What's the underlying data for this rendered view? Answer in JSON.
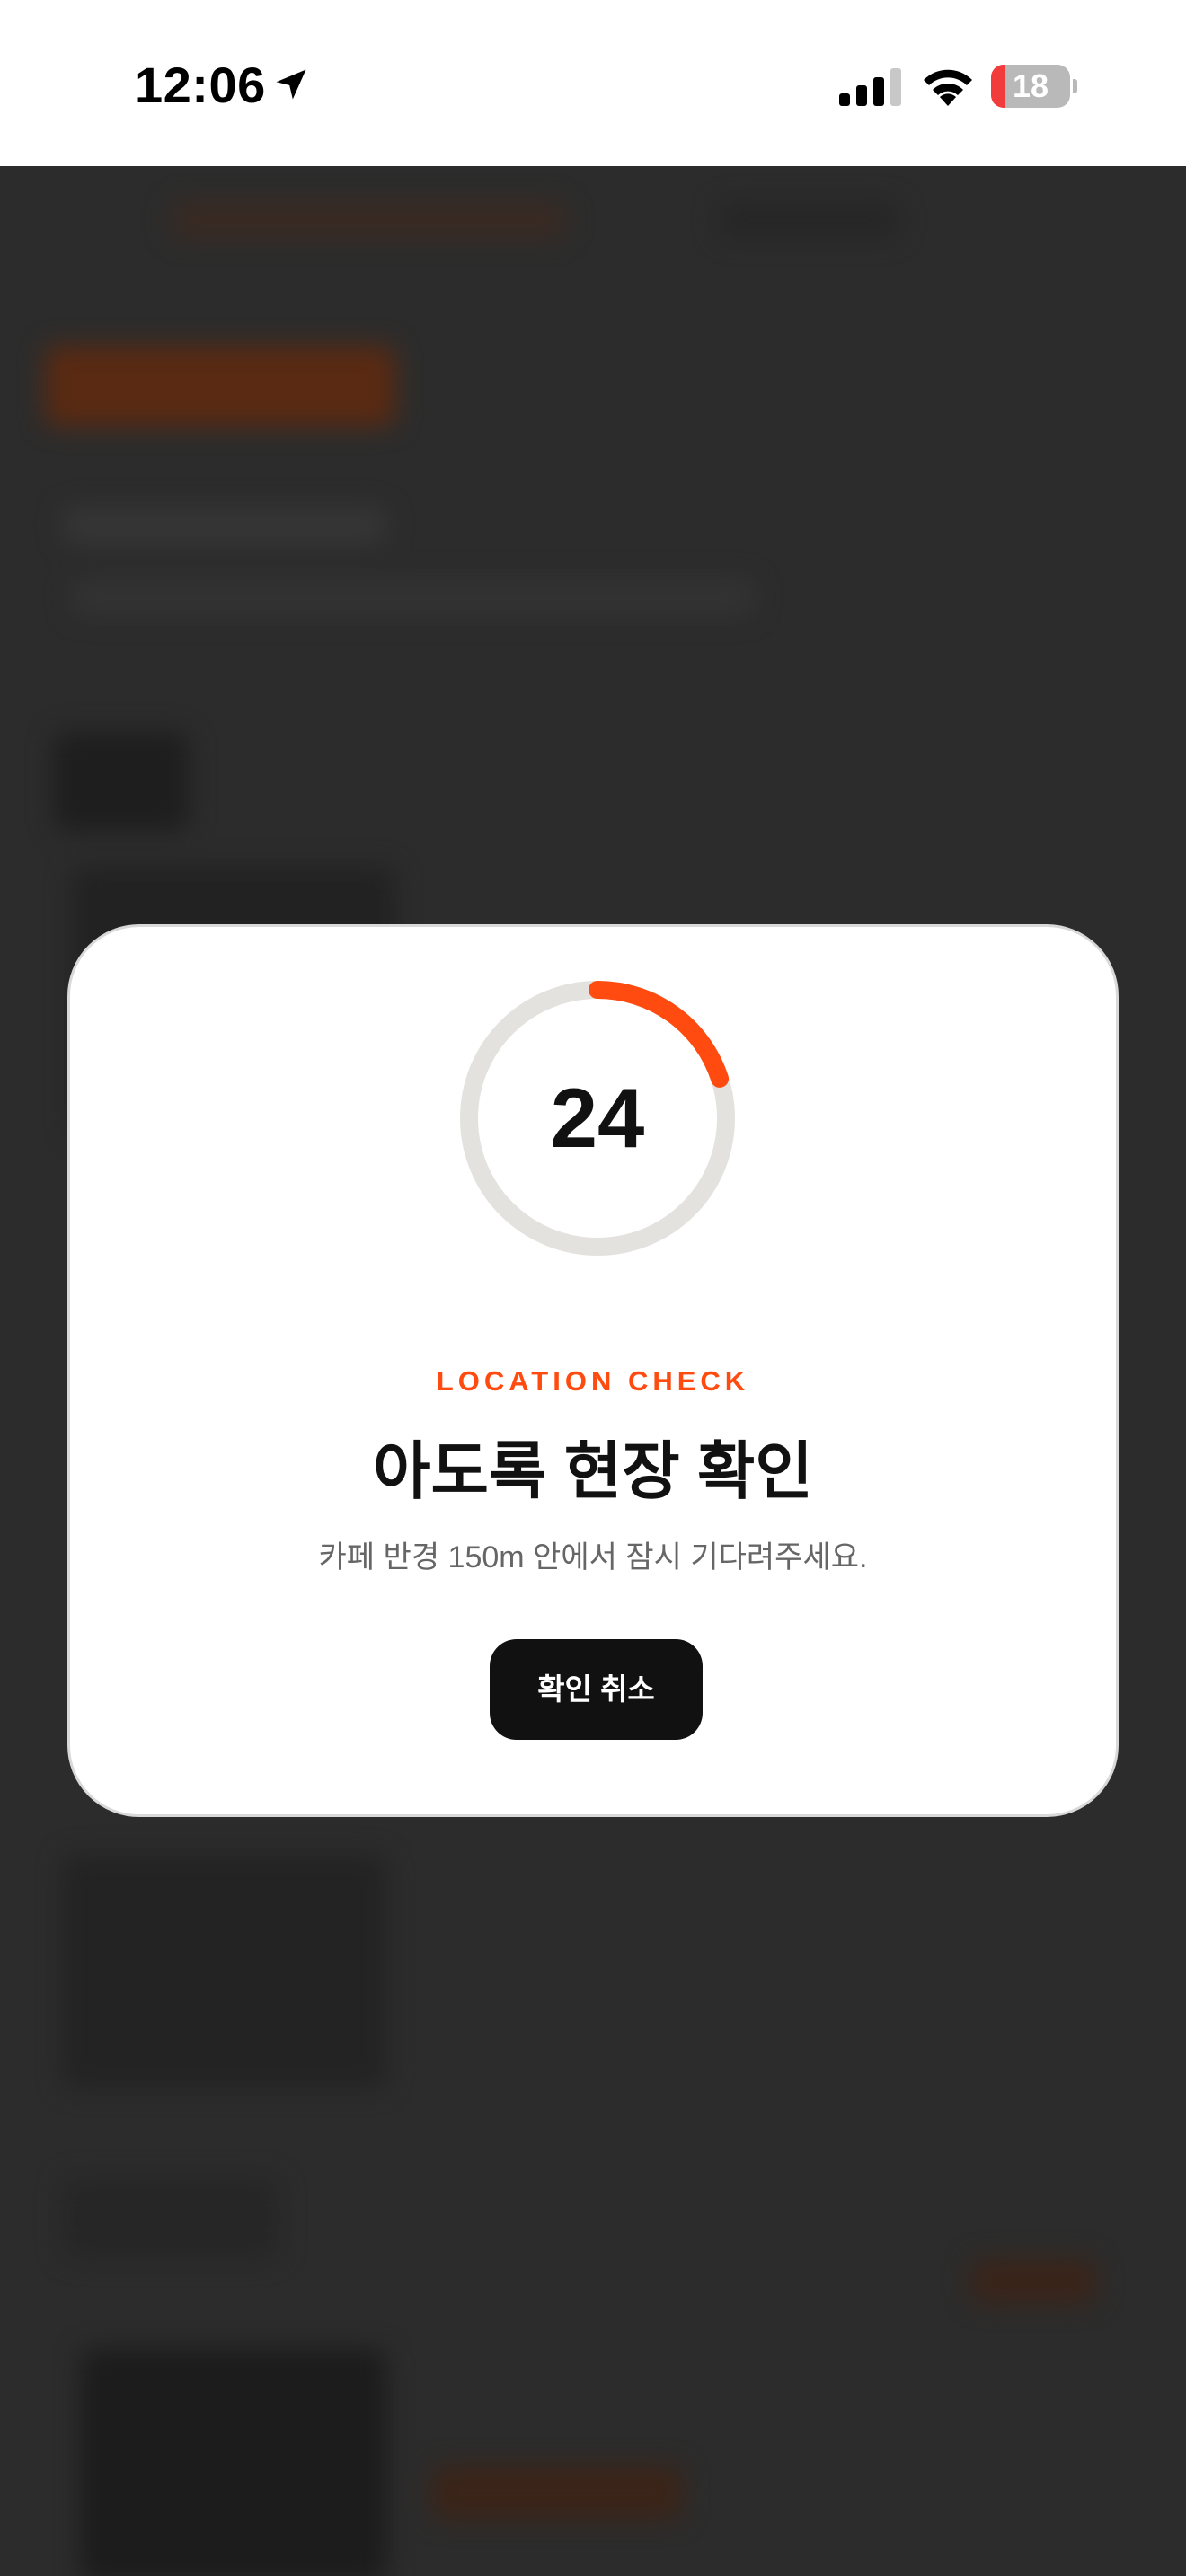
{
  "status_bar": {
    "time": "12:06",
    "battery_level": "18",
    "battery_fraction": 0.18,
    "icons": [
      "location-arrow-icon",
      "signal-icon",
      "wifi-icon",
      "battery-icon"
    ]
  },
  "modal": {
    "countdown": "24",
    "countdown_progress": 0.2,
    "eyebrow": "LOCATION CHECK",
    "title": "아도록 현장 확인",
    "description": "카페 반경 150m 안에서 잠시 기다려주세요.",
    "cancel_label": "확인 취소"
  },
  "colors": {
    "accent": "#ff4b0f",
    "ring_track": "#e3e2df",
    "button_bg": "#111111",
    "overlay": "#2c2c2c",
    "battery_low": "#f23b3b"
  }
}
